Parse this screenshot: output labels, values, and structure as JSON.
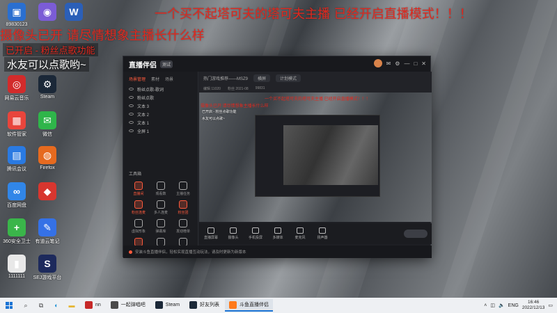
{
  "overlay": {
    "line1": "一个买不起塔可夫的塔可夫主播 已经开启直播模式！！！",
    "line2": "摄像头已开 请尽情想象主播长什么样",
    "line3": "已开启 - 粉丝点歌功能",
    "line4": "水友可以点歌哟~"
  },
  "desktop_icons": [
    {
      "label": "89830123",
      "color": "#2a6fd0",
      "glyph": "▣"
    },
    {
      "label": "",
      "color": "#7b5cd6",
      "glyph": "◉"
    },
    {
      "label": "",
      "color": "#2b5fb8",
      "glyph": "W"
    },
    {
      "label": "网易云音乐",
      "color": "#d22b2b",
      "glyph": "◎"
    },
    {
      "label": "Steam",
      "color": "#1b2838",
      "glyph": "⚙"
    },
    {
      "label": "软件管家",
      "color": "#e8453c",
      "glyph": "▦"
    },
    {
      "label": "微信",
      "color": "#2fb54a",
      "glyph": "✉"
    },
    {
      "label": "腾讯会议",
      "color": "#2a7ae2",
      "glyph": "▤"
    },
    {
      "label": "Firefox",
      "color": "#e66a1f",
      "glyph": "◍"
    },
    {
      "label": "百度网盘",
      "color": "#3186e8",
      "glyph": "∞"
    },
    {
      "label": "",
      "color": "#d8362f",
      "glyph": "◆"
    },
    {
      "label": "360安全卫士",
      "color": "#3ab54a",
      "glyph": "+"
    },
    {
      "label": "有道云笔记",
      "color": "#3571e6",
      "glyph": "✎"
    },
    {
      "label": "1111111",
      "color": "#e8e8e8",
      "glyph": "▮"
    },
    {
      "label": "SEJ游戏平台",
      "color": "#1d2a5c",
      "glyph": "S"
    }
  ],
  "app": {
    "logo": "直播伴侣",
    "version": "测试",
    "left_tabs": [
      "场景管理",
      "素材",
      "场景"
    ],
    "scenes": [
      "粉丝点歌-歌词",
      "粉丝点歌",
      "文本 3",
      "文本 2",
      "文本 1",
      "全屏 1"
    ],
    "tools_title": "工具箱",
    "tools": [
      {
        "label": "直播间",
        "highlight": true
      },
      {
        "label": "观看数",
        "highlight": false
      },
      {
        "label": "主播任务",
        "highlight": false
      },
      {
        "label": "粉丝连麦",
        "highlight": true
      },
      {
        "label": "多人连麦",
        "highlight": false
      },
      {
        "label": "粉丝团",
        "highlight": true
      },
      {
        "label": "虚拟形象",
        "highlight": false
      },
      {
        "label": "弹幕库",
        "highlight": false
      },
      {
        "label": "发动榜单",
        "highlight": false
      },
      {
        "label": "",
        "highlight": true
      },
      {
        "label": "",
        "highlight": false
      },
      {
        "label": "",
        "highlight": false
      }
    ],
    "topbar": {
      "title": "热门游戏推荐——MSZ9",
      "mode": "横屏",
      "pill": "计划模式"
    },
    "subbar": [
      "编辑 11020",
      "粉丝 2021-08",
      "99831"
    ],
    "preview": {
      "red1": "一个买不起塔可夫的塔可夫主播 已经开启直播模式！！！",
      "red2": "摄像头已开 请尽情想象主播长什么样",
      "white1": "已开启 - 粉丝点歌功能",
      "white2": "水友可以点歌~"
    },
    "controls": [
      "直播屏幕",
      "摄像头",
      "手机投屏",
      "多媒体",
      "麦克风",
      "扬声器"
    ],
    "tip": "安装斗鱼直播伴侣，轻松实现直播互动玩法，请及时更新为新版本"
  },
  "taskbar": {
    "apps": [
      {
        "label": "nn",
        "color": "#c62828",
        "active": false
      },
      {
        "label": "一起弹唱吧",
        "color": "#4a4a4a",
        "active": false
      },
      {
        "label": "Steam",
        "color": "#1b2838",
        "active": false
      },
      {
        "label": "好友列表",
        "color": "#1b2838",
        "active": false
      },
      {
        "label": "斗鱼直播伴侣",
        "color": "#ff7a1a",
        "active": true
      }
    ],
    "lang": "ENG",
    "time": "16:46",
    "date": "2022/12/13"
  },
  "colors": {
    "overlay_red": "#e0281e",
    "accent": "#ff5a3c",
    "taskbar_active": "#1a73d4"
  }
}
